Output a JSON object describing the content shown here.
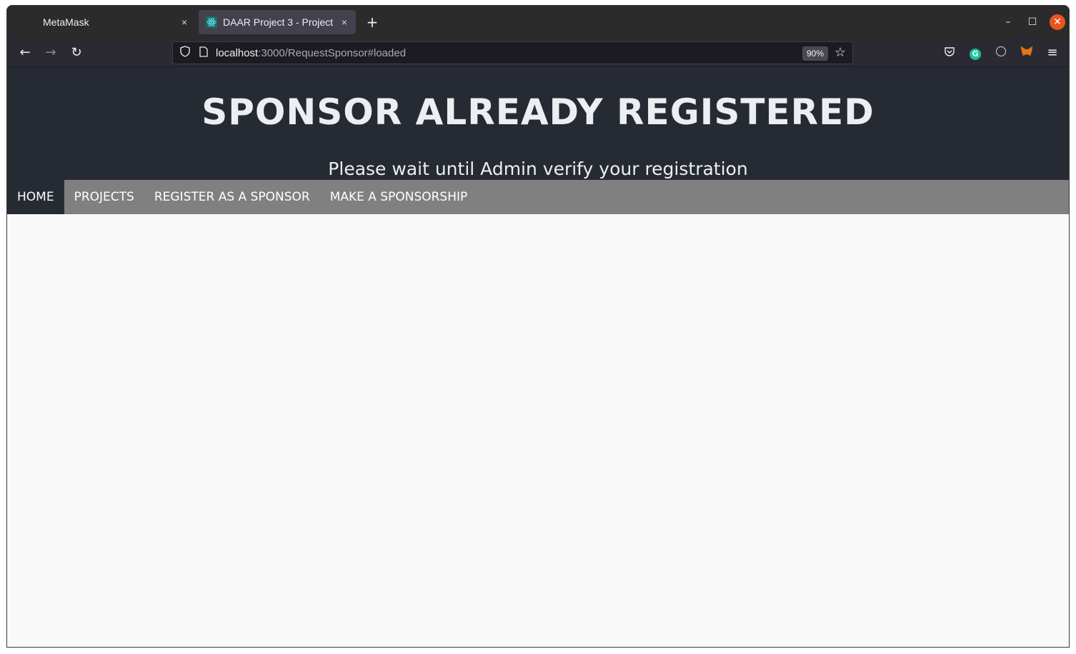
{
  "browser": {
    "tabs": [
      {
        "title": "MetaMask",
        "close": "×"
      },
      {
        "title": "DAAR Project 3 - Project",
        "close": "×"
      }
    ],
    "new_tab": "+",
    "url_host": "localhost",
    "url_path": ":3000/RequestSponsor#loaded",
    "zoom": "90%"
  },
  "page": {
    "heading": "SPONSOR ALREADY REGISTERED",
    "subheading": "Please wait until Admin verify your registration",
    "nav": [
      {
        "label": "HOME",
        "active": true
      },
      {
        "label": "PROJECTS"
      },
      {
        "label": "REGISTER AS A SPONSOR"
      },
      {
        "label": "MAKE A SPONSORSHIP"
      }
    ]
  },
  "colors": {
    "hero_bg": "#262b33",
    "navbar_bg": "#808080",
    "active_nav_bg": "#262b33",
    "page_bg": "#f9f9f9"
  }
}
